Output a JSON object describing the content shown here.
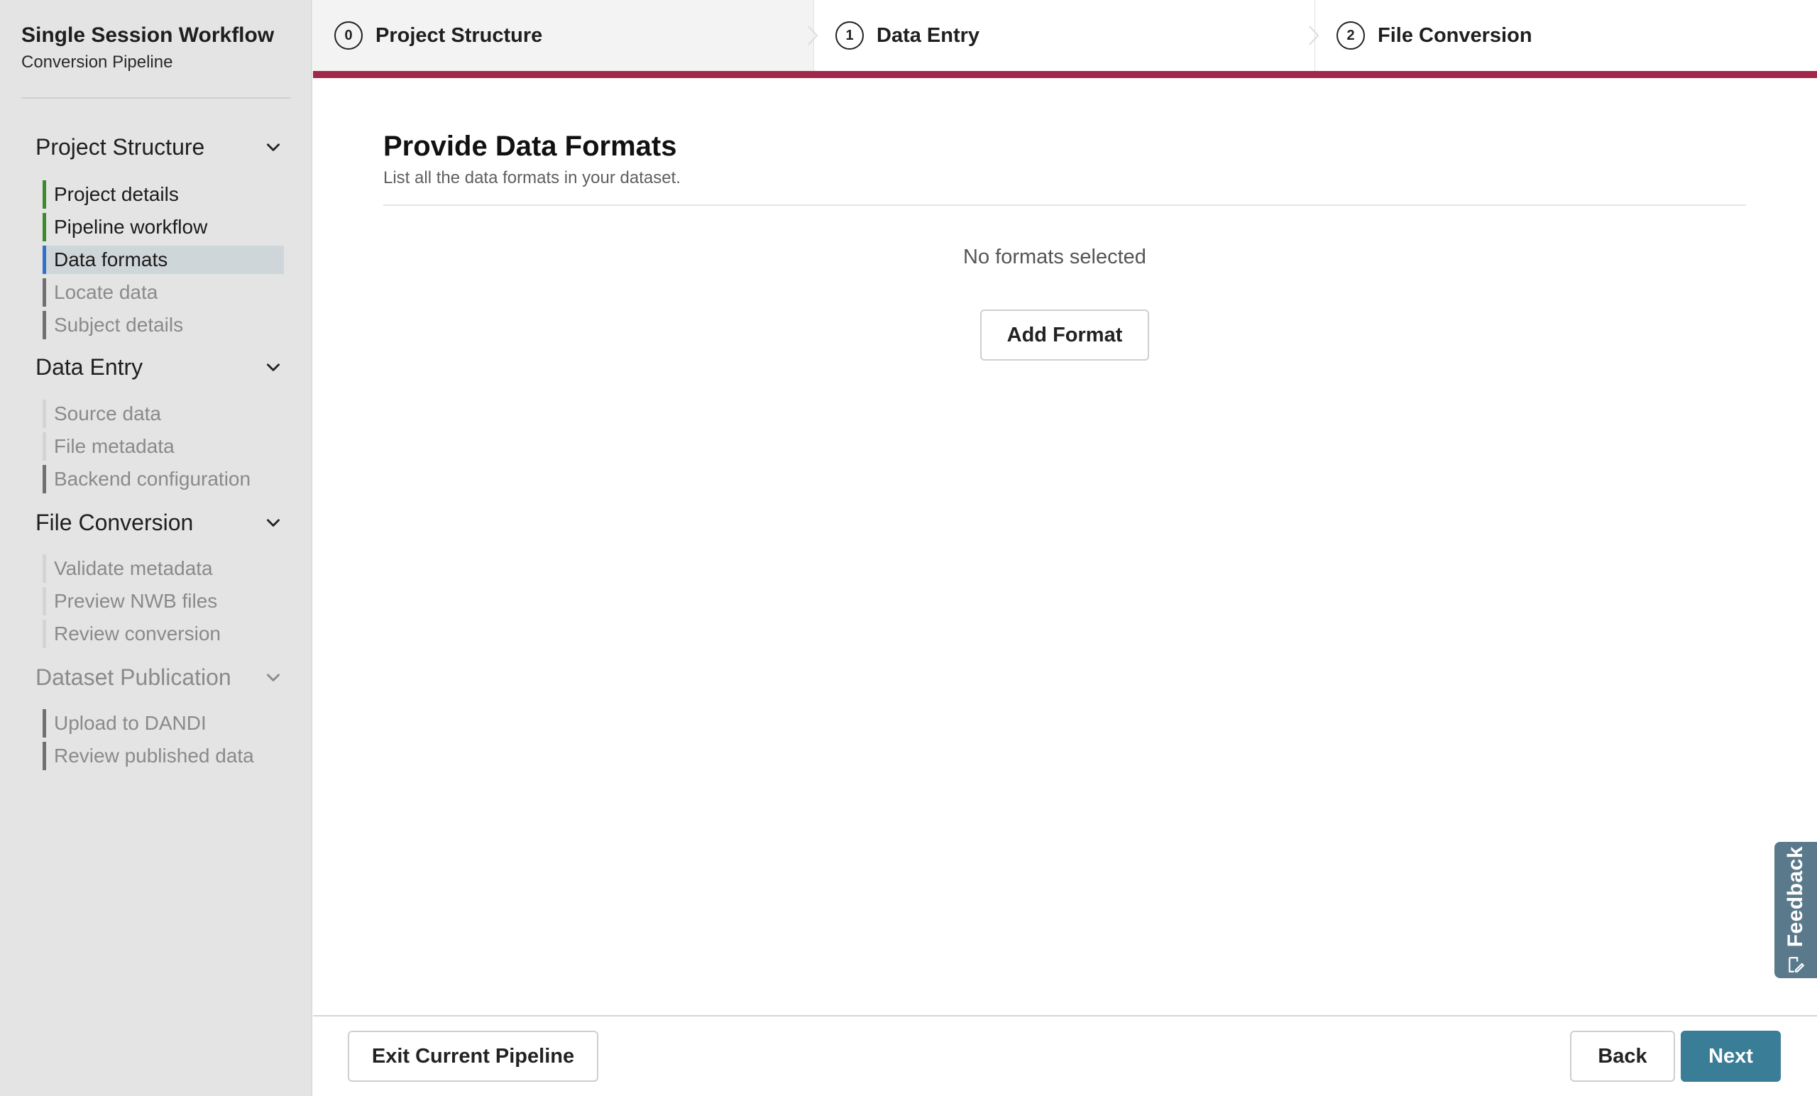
{
  "sidebar": {
    "title": "Single Session Workflow",
    "subtitle": "Conversion Pipeline",
    "sections": [
      {
        "title": "Project Structure",
        "items": [
          {
            "label": "Project details",
            "state": "done"
          },
          {
            "label": "Pipeline workflow",
            "state": "done"
          },
          {
            "label": "Data formats",
            "state": "active"
          },
          {
            "label": "Locate data",
            "state": "pending"
          },
          {
            "label": "Subject details",
            "state": "pending"
          }
        ]
      },
      {
        "title": "Data Entry",
        "items": [
          {
            "label": "Source data",
            "state": "locked"
          },
          {
            "label": "File metadata",
            "state": "locked"
          },
          {
            "label": "Backend configuration",
            "state": "pending"
          }
        ]
      },
      {
        "title": "File Conversion",
        "items": [
          {
            "label": "Validate metadata",
            "state": "locked"
          },
          {
            "label": "Preview NWB files",
            "state": "locked"
          },
          {
            "label": "Review conversion",
            "state": "locked"
          }
        ]
      },
      {
        "title": "Dataset Publication",
        "items": [
          {
            "label": "Upload to DANDI",
            "state": "pending"
          },
          {
            "label": "Review published data",
            "state": "pending"
          }
        ]
      }
    ]
  },
  "steps": [
    {
      "number": "0",
      "label": "Project Structure"
    },
    {
      "number": "1",
      "label": "Data Entry"
    },
    {
      "number": "2",
      "label": "File Conversion"
    }
  ],
  "main": {
    "title": "Provide Data Formats",
    "description": "List all the data formats in your dataset.",
    "empty_message": "No formats selected",
    "add_button": "Add Format"
  },
  "footer": {
    "exit_label": "Exit Current Pipeline",
    "back_label": "Back",
    "next_label": "Next"
  },
  "feedback": {
    "label": "Feedback"
  },
  "colors": {
    "progress": "#a1284a",
    "done": "#3c8a2e",
    "active": "#2f73c9",
    "next_button": "#3a7d96"
  }
}
